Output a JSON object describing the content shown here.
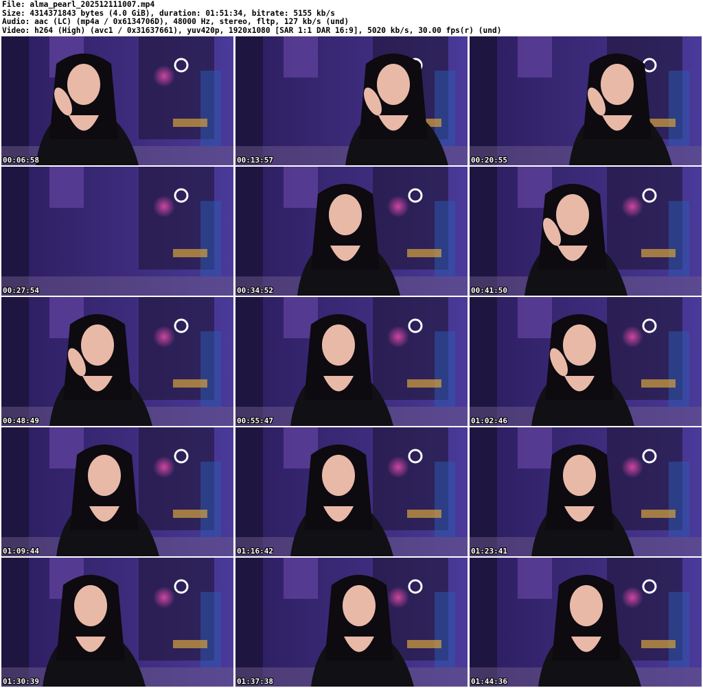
{
  "header": {
    "file_line": "File: alma_pearl_202512111007.mp4",
    "size_line": "Size: 4314371843 bytes (4.0 GiB), duration: 01:51:34, bitrate: 5155 kb/s",
    "audio_line": "Audio: aac (LC) (mp4a / 0x6134706D), 48000 Hz, stereo, fltp, 127 kb/s (und)",
    "video_line": "Video: h264 (High) (avc1 / 0x31637661), yuv420p, 1920x1080 [SAR 1:1 DAR 16:9], 5020 kb/s, 30.00 fps(r) (und)"
  },
  "thumbnails": [
    {
      "timestamp": "00:06:58"
    },
    {
      "timestamp": "00:13:57"
    },
    {
      "timestamp": "00:20:55"
    },
    {
      "timestamp": "00:27:54"
    },
    {
      "timestamp": "00:34:52"
    },
    {
      "timestamp": "00:41:50"
    },
    {
      "timestamp": "00:48:49"
    },
    {
      "timestamp": "00:55:47"
    },
    {
      "timestamp": "01:02:46"
    },
    {
      "timestamp": "01:09:44"
    },
    {
      "timestamp": "01:16:42"
    },
    {
      "timestamp": "01:23:41"
    },
    {
      "timestamp": "01:30:39"
    },
    {
      "timestamp": "01:37:38"
    },
    {
      "timestamp": "01:44:36"
    }
  ],
  "colors": {
    "wall_purple": "#3b2a78",
    "room_dark": "#1c1330",
    "neon_pink": "#e04aa8",
    "ring_light": "#ffffff",
    "hair": "#0d0a10",
    "top_black": "#111015",
    "skin": "#e9b9a8"
  }
}
